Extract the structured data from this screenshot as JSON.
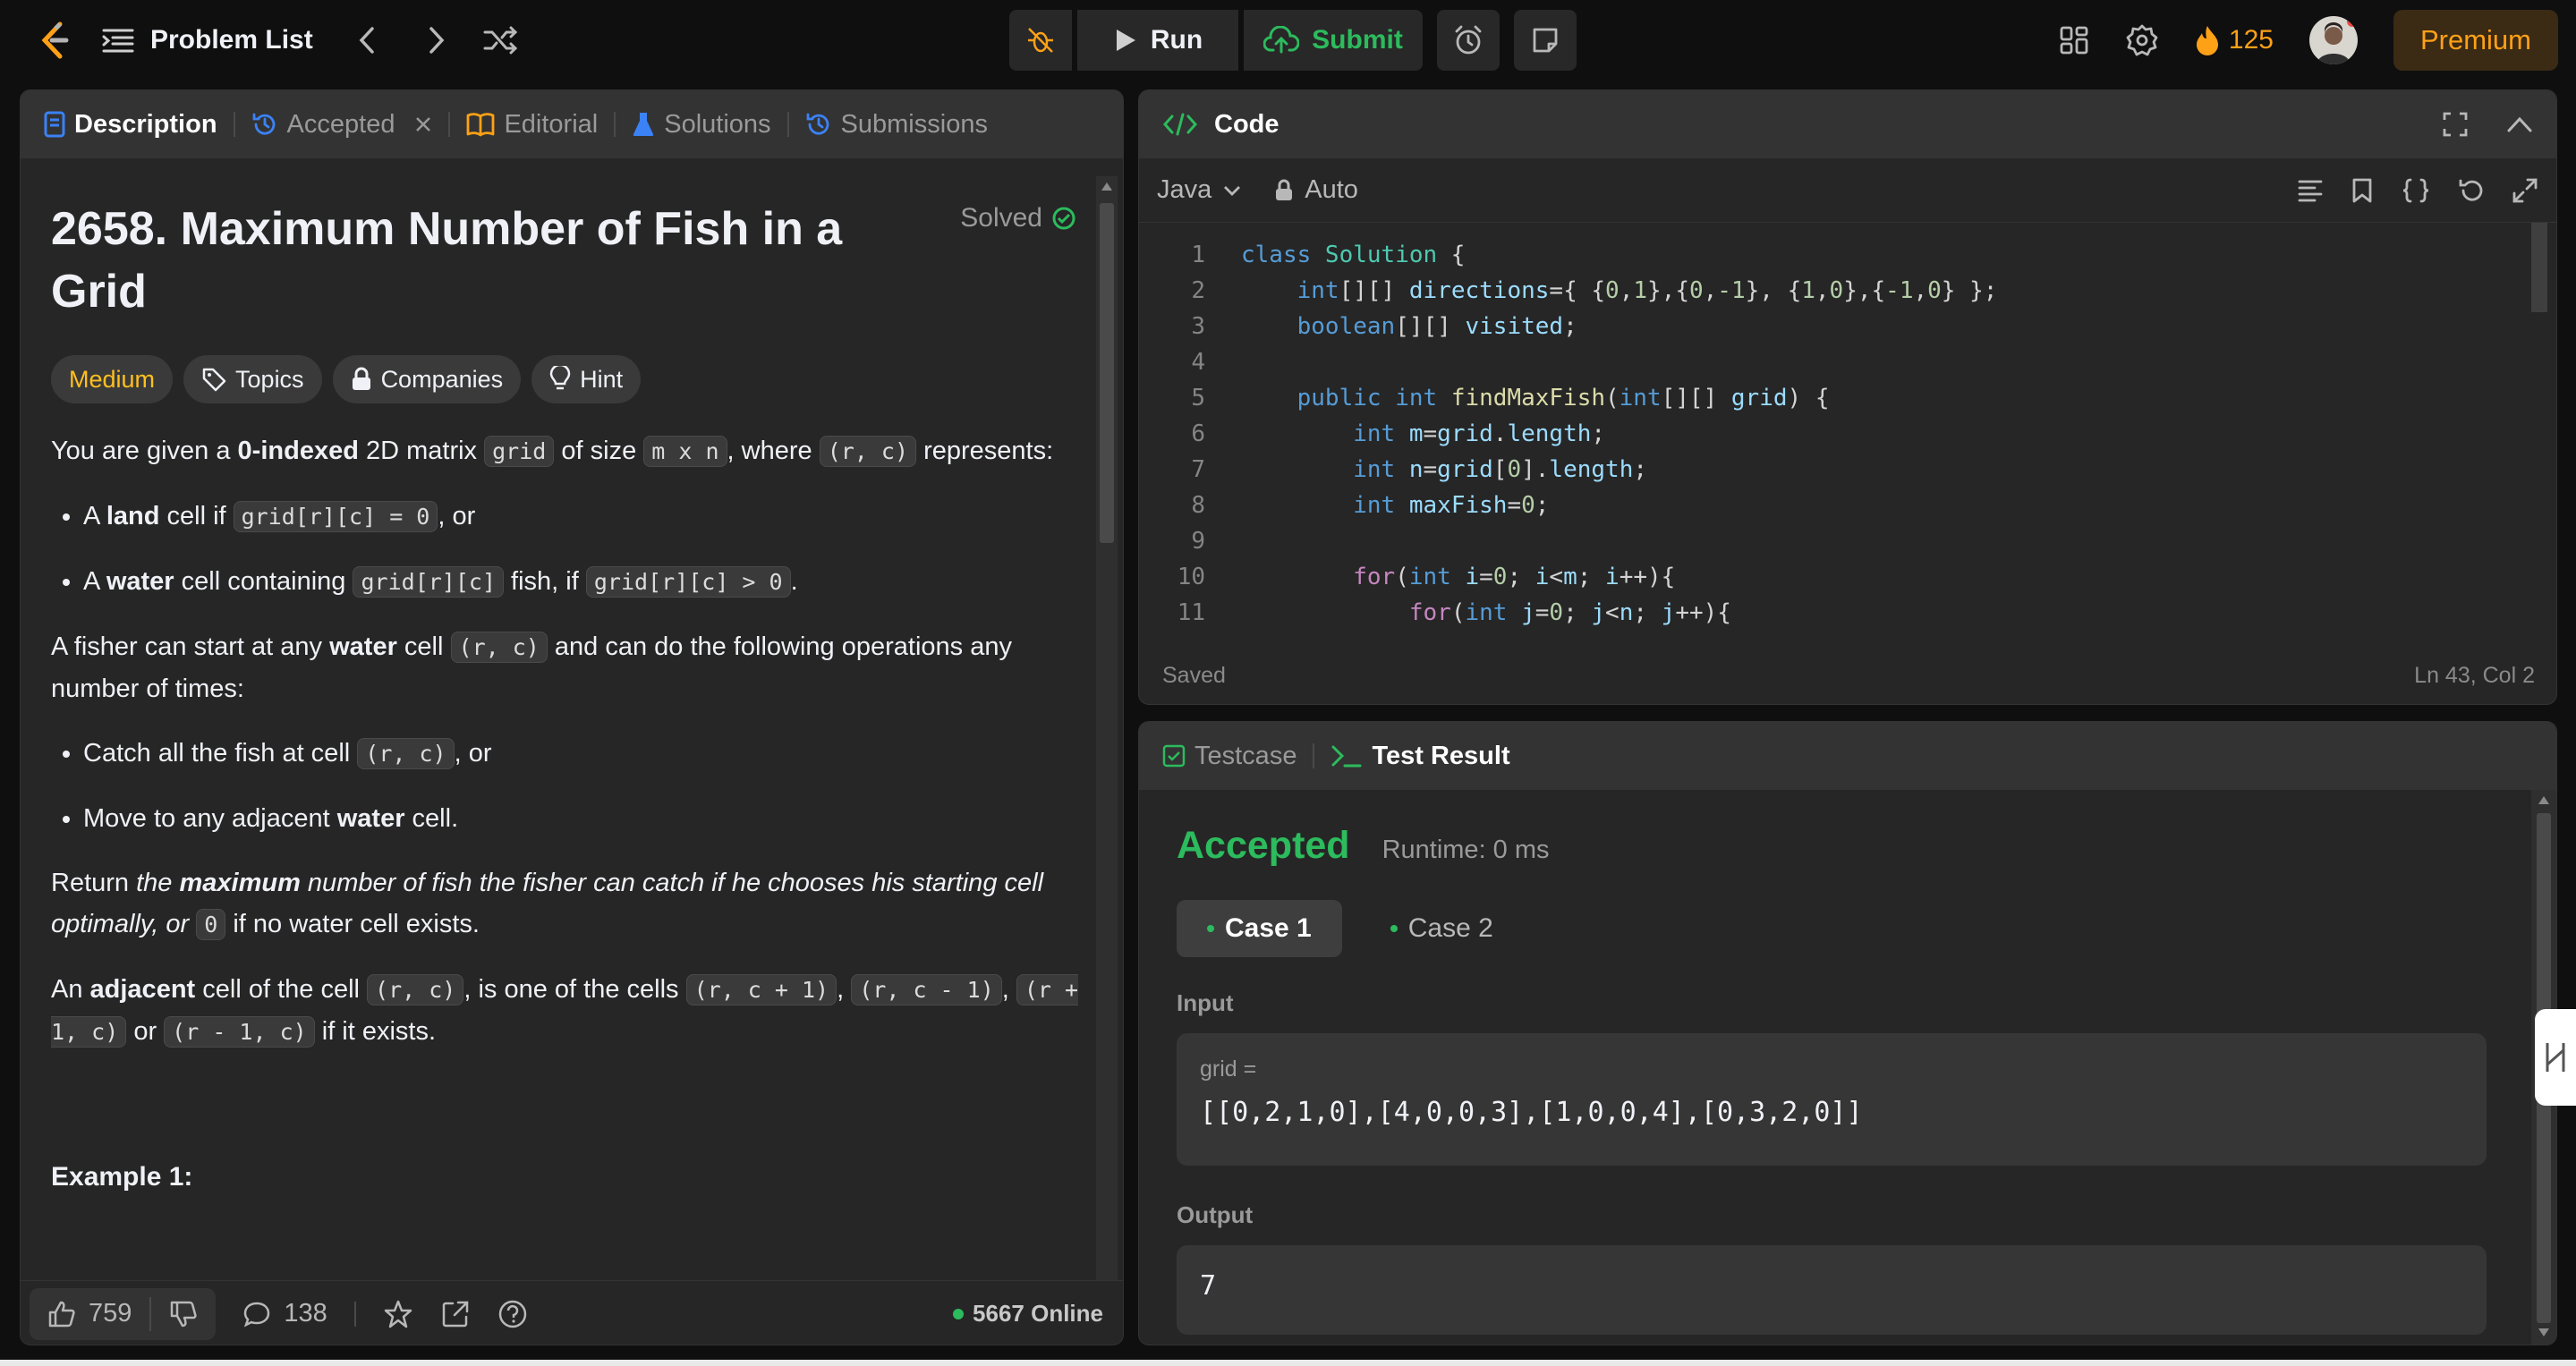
{
  "topbar": {
    "title": "Problem List",
    "run_label": "Run",
    "submit_label": "Submit",
    "streak": "125",
    "premium": "Premium"
  },
  "left_panel": {
    "tabs": [
      {
        "label": "Description"
      },
      {
        "label": "Accepted"
      },
      {
        "label": "Editorial"
      },
      {
        "label": "Solutions"
      },
      {
        "label": "Submissions"
      }
    ],
    "problem_title": "2658. Maximum Number of Fish in a Grid",
    "solved_label": "Solved",
    "chips": {
      "difficulty": "Medium",
      "topics": "Topics",
      "companies": "Companies",
      "hint": "Hint"
    },
    "description": {
      "p1_a": "You are given a ",
      "p1_b": "0-indexed",
      "p1_c": " 2D matrix ",
      "p1_code1": "grid",
      "p1_d": " of size ",
      "p1_code2": "m x n",
      "p1_e": ", where ",
      "p1_code3": "(r, c)",
      "p1_f": " represents:",
      "li1_a": "A ",
      "li1_b": "land",
      "li1_c": " cell if ",
      "li1_code": "grid[r][c] = 0",
      "li1_d": ", or",
      "li2_a": "A ",
      "li2_b": "water",
      "li2_c": " cell containing ",
      "li2_code1": "grid[r][c]",
      "li2_d": " fish, if ",
      "li2_code2": "grid[r][c] > 0",
      "li2_e": ".",
      "p2_a": "A fisher can start at any ",
      "p2_b": "water",
      "p2_c": " cell ",
      "p2_code": "(r, c)",
      "p2_d": " and can do the following operations any number of times:",
      "li3_a": "Catch all the fish at cell ",
      "li3_code": "(r, c)",
      "li3_b": ", or",
      "li4_a": "Move to any adjacent ",
      "li4_b": "water",
      "li4_c": " cell.",
      "p3_a": "Return ",
      "p3_b": "the ",
      "p3_c": "maximum",
      "p3_d": " number of fish the fisher can catch if he chooses his starting cell optimally, or ",
      "p3_code": "0",
      "p3_e": " if no water cell exists.",
      "p4_a": "An ",
      "p4_b": "adjacent",
      "p4_c": " cell of the cell ",
      "p4_code1": "(r, c)",
      "p4_d": ", is one of the cells ",
      "p4_code2": "(r, c + 1)",
      "p4_e": ", ",
      "p4_code3": "(r, c - 1)",
      "p4_f": ", ",
      "p4_code4": "(r + 1, c)",
      "p4_g": " or ",
      "p4_code5": "(r - 1, c)",
      "p4_h": " if it exists.",
      "example": "Example 1:"
    },
    "footer": {
      "likes": "759",
      "comments": "138",
      "online": "5667 Online"
    }
  },
  "code_panel": {
    "title": "Code",
    "language": "Java",
    "mode": "Auto",
    "status": "Saved",
    "cursor": "Ln 43, Col 2",
    "lines": [
      "1",
      "2",
      "3",
      "4",
      "5",
      "6",
      "7",
      "8",
      "9",
      "10",
      "11"
    ]
  },
  "result_panel": {
    "tab1": "Testcase",
    "tab2": "Test Result",
    "verdict": "Accepted",
    "runtime": "Runtime: 0 ms",
    "case1": "Case 1",
    "case2": "Case 2",
    "input_label": "Input",
    "input_var": "grid =",
    "input_value": "[[0,2,1,0],[4,0,0,3],[1,0,0,4],[0,3,2,0]]",
    "output_label": "Output",
    "output_value": "7"
  },
  "colors": {
    "accent_green": "#2cbb5d",
    "medium": "#ffc01e",
    "streak": "#ffa116",
    "link_blue": "#3b82f6"
  }
}
